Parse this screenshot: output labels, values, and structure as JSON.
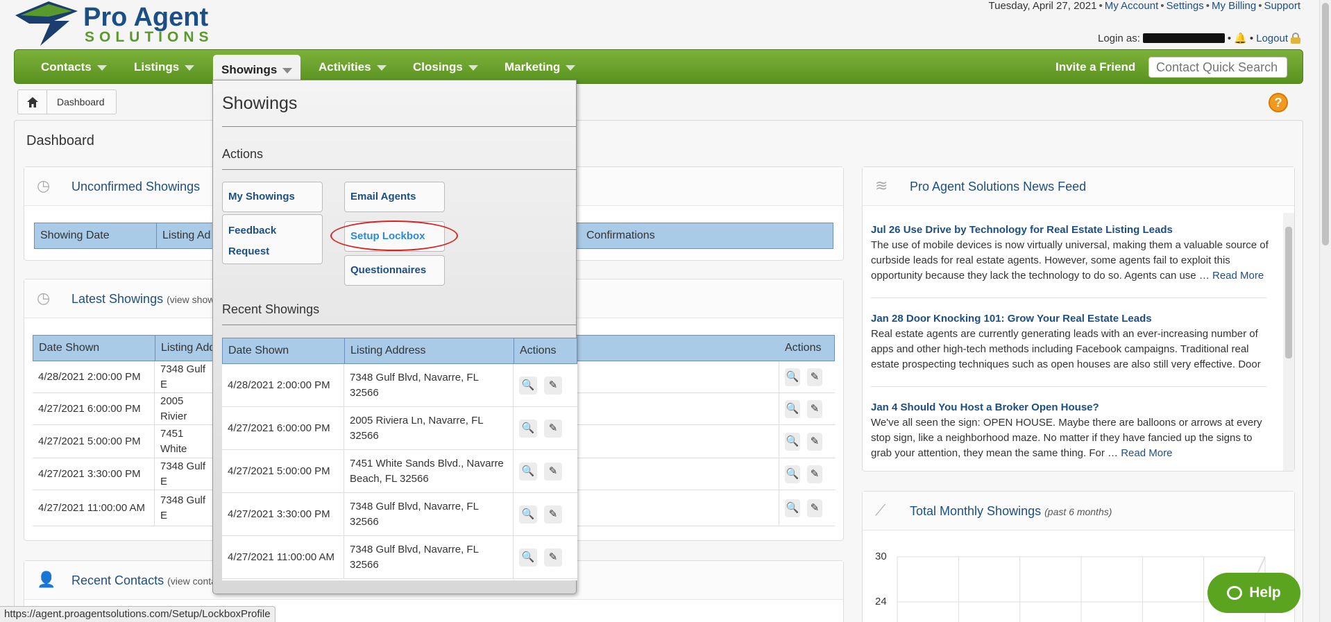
{
  "header": {
    "logo_line1": "Pro Agent",
    "logo_line2": "SOLUTIONS",
    "date": "Tuesday, April 27, 2021",
    "links": [
      "My Account",
      "Settings",
      "My Billing",
      "Support"
    ],
    "login_label": "Login as:",
    "logout": "Logout"
  },
  "nav": {
    "items": [
      {
        "label": "Contacts"
      },
      {
        "label": "Listings"
      },
      {
        "label": "Showings"
      },
      {
        "label": "Activities"
      },
      {
        "label": "Closings"
      },
      {
        "label": "Marketing"
      }
    ],
    "invite": "Invite a Friend",
    "search_placeholder": "Contact Quick Search"
  },
  "breadcrumb": {
    "current": "Dashboard"
  },
  "dashboard": {
    "title": "Dashboard",
    "unconfirmed": {
      "title": "Unconfirmed Showings",
      "columns": [
        "Showing Date",
        "Listing Ad",
        "Confirmations"
      ]
    },
    "latest": {
      "title": "Latest Showings",
      "subtitle": "(view show",
      "columns": [
        "Date Shown",
        "Listing Add",
        "Actions"
      ],
      "rows": [
        {
          "date": "4/28/2021 2:00:00 PM",
          "addr": "7348 Gulf E"
        },
        {
          "date": "4/27/2021 6:00:00 PM",
          "addr": "2005 Rivier"
        },
        {
          "date": "4/27/2021 5:00:00 PM",
          "addr": "7451 White"
        },
        {
          "date": "4/27/2021 3:30:00 PM",
          "addr": "7348 Gulf E"
        },
        {
          "date": "4/27/2021 11:00:00 AM",
          "addr": "7348 Gulf E"
        }
      ]
    },
    "contacts": {
      "title": "Recent Contacts",
      "subtitle": "(view conta"
    }
  },
  "news": {
    "title": "Pro Agent Solutions News Feed",
    "items": [
      {
        "title": "Jul 26 Use Drive by Technology for Real Estate Listing Leads",
        "body": "The use of mobile devices is now virtually universal, making them a valuable source of curbside leads for real estate agents. However, some agents fail to exploit this opportunity because they lack the technology to do so. Agents can use …",
        "more": "Read More"
      },
      {
        "title": "Jan 28 Door Knocking 101: Grow Your Real Estate Leads",
        "body": "Real estate agents are currently generating leads with an ever-increasing number of apps and other high-tech methods including Facebook campaigns. Traditional real estate prospecting techniques such as open houses are also still very effective. Door",
        "more": ""
      },
      {
        "title": "Jan 4 Should You Host a Broker Open House?",
        "body": "We've all seen the sign: OPEN HOUSE. Maybe there are balloons or arrows at every stop sign, like a neighborhood maze. No matter if they have fancied up the signs to grab your attention, they mean the same thing. For …",
        "more": "Read More"
      }
    ]
  },
  "chart": {
    "title": "Total Monthly Showings",
    "subtitle": "(past 6 months)"
  },
  "chart_data": {
    "type": "line",
    "title": "Total Monthly Showings",
    "subtitle": "(past 6 months)",
    "y_ticks": [
      30,
      24
    ],
    "grid": true
  },
  "dropdown": {
    "title": "Showings",
    "actions_label": "Actions",
    "buttons": [
      "My Showings",
      "Email Agents",
      "Feedback Request",
      "Setup Lockbox",
      "Questionnaires"
    ],
    "recent_label": "Recent Showings",
    "columns": [
      "Date Shown",
      "Listing Address",
      "Actions"
    ],
    "rows": [
      {
        "date": "4/28/2021 2:00:00 PM",
        "addr": "7348 Gulf Blvd, Navarre, FL 32566"
      },
      {
        "date": "4/27/2021 6:00:00 PM",
        "addr": "2005 Riviera Ln, Navarre, FL 32566"
      },
      {
        "date": "4/27/2021 5:00:00 PM",
        "addr": "7451 White Sands Blvd., Navarre Beach, FL 32566"
      },
      {
        "date": "4/27/2021 3:30:00 PM",
        "addr": "7348 Gulf Blvd, Navarre, FL 32566"
      },
      {
        "date": "4/27/2021 11:00:00 AM",
        "addr": "7348 Gulf Blvd, Navarre, FL 32566"
      }
    ]
  },
  "help": "Help",
  "status_url": "https://agent.proagentsolutions.com/Setup/LockboxProfile",
  "colors": {
    "nav_green": "#6aa22c",
    "link_blue": "#1c4f86",
    "header_blue": "#a9cbe8"
  }
}
